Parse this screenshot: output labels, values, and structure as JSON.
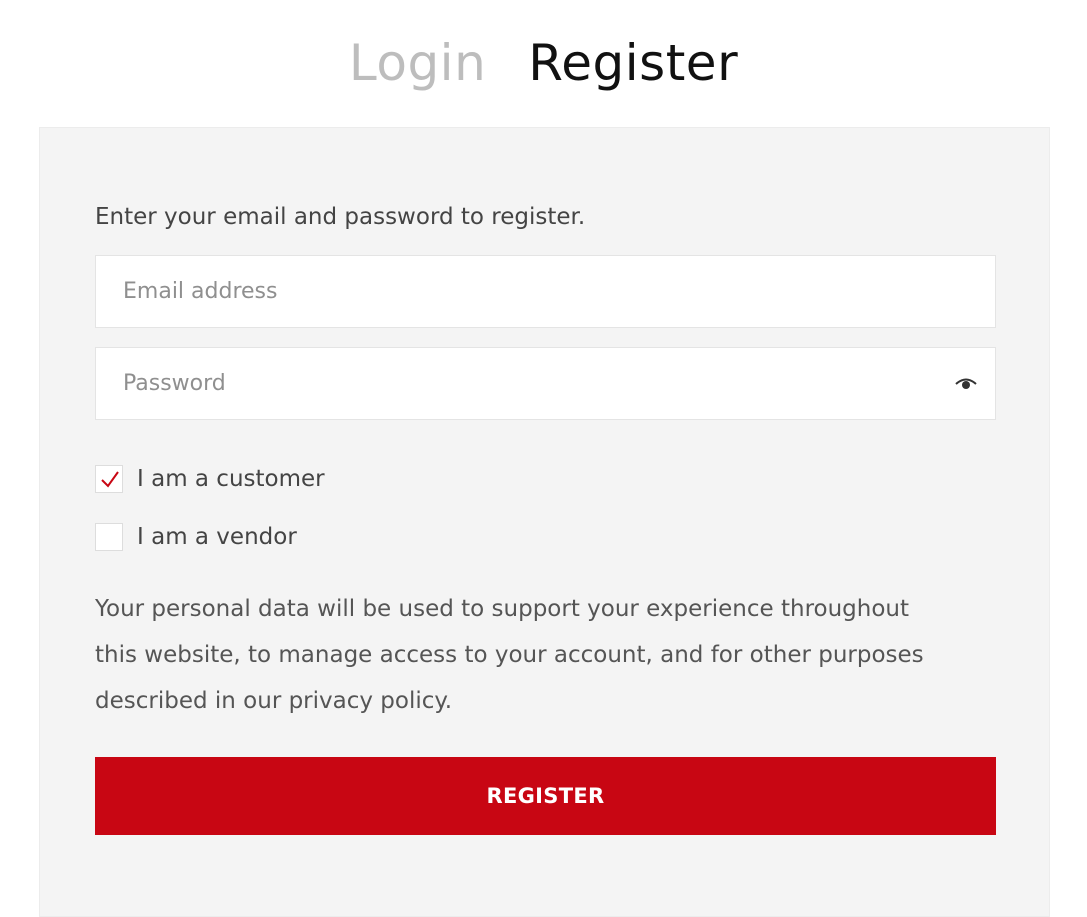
{
  "tabs": {
    "login": "Login",
    "register": "Register"
  },
  "form": {
    "intro": "Enter your email and password to register.",
    "email_placeholder": "Email address",
    "email_value": "",
    "password_placeholder": "Password",
    "password_value": "",
    "password_toggle_icon": "eye-icon",
    "roles": [
      {
        "label": "I am a customer",
        "checked": true
      },
      {
        "label": "I am a vendor",
        "checked": false
      }
    ],
    "privacy_lines": [
      "Your personal data will be used to support your experience throughout",
      "this website, to manage access to your account, and for other purposes",
      "described in our privacy policy."
    ],
    "submit_label": "REGISTER"
  },
  "colors": {
    "accent": "#c80613",
    "panel_bg": "#f4f4f4",
    "inactive_tab": "#bdbdbd"
  }
}
